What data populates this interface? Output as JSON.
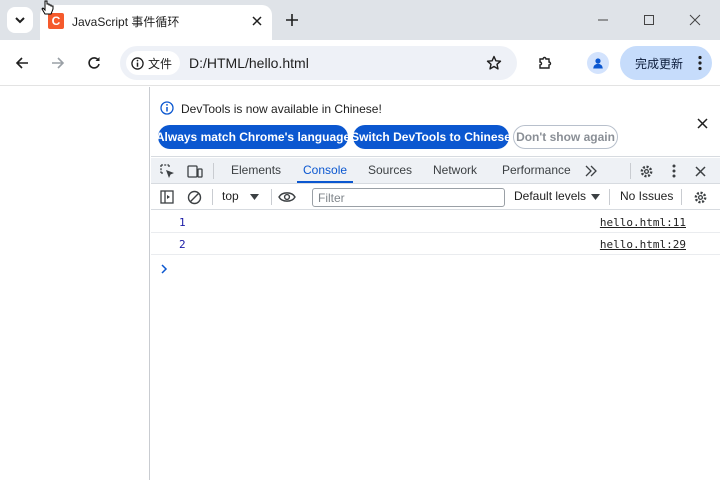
{
  "browser": {
    "tab_title": "JavaScript 事件循环",
    "favicon_letter": "C",
    "site_chip_label": "文件",
    "url": "D:/HTML/hello.html",
    "update_label": "完成更新"
  },
  "devtools": {
    "infobar": {
      "message": "DevTools is now available in Chinese!",
      "btn_match": "Always match Chrome's language",
      "btn_switch": "Switch DevTools to Chinese",
      "btn_dismiss": "Don't show again"
    },
    "tabs": [
      "Elements",
      "Console",
      "Sources",
      "Network",
      "Performance"
    ],
    "active_tab": "Console",
    "console": {
      "context": "top",
      "filter_placeholder": "Filter",
      "levels": "Default levels",
      "issues": "No Issues",
      "logs": [
        {
          "value": "1",
          "source": "hello.html:11"
        },
        {
          "value": "2",
          "source": "hello.html:29"
        }
      ]
    }
  },
  "colors": {
    "accent": "#0b57d0",
    "titlebar_bg": "#dfe3e8",
    "update_btn_bg": "#c6dcfb",
    "favicon": "#f55a2c"
  }
}
